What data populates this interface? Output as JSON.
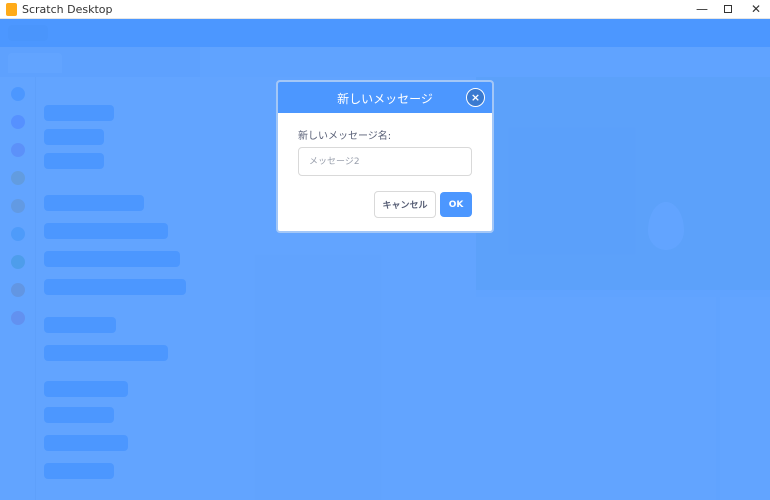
{
  "window": {
    "title": "Scratch Desktop",
    "minimize_glyph": "—",
    "close_glyph": "✕"
  },
  "dialog": {
    "title": "新しいメッセージ",
    "close_glyph": "×",
    "prompt_label": "新しいメッセージ名:",
    "input_placeholder": "メッセージ2",
    "input_value": "",
    "cancel_label": "キャンセル",
    "ok_label": "OK"
  },
  "colors": {
    "overlay": "#4c97ff",
    "accent": "#4c97ff",
    "text": "#575e75"
  }
}
